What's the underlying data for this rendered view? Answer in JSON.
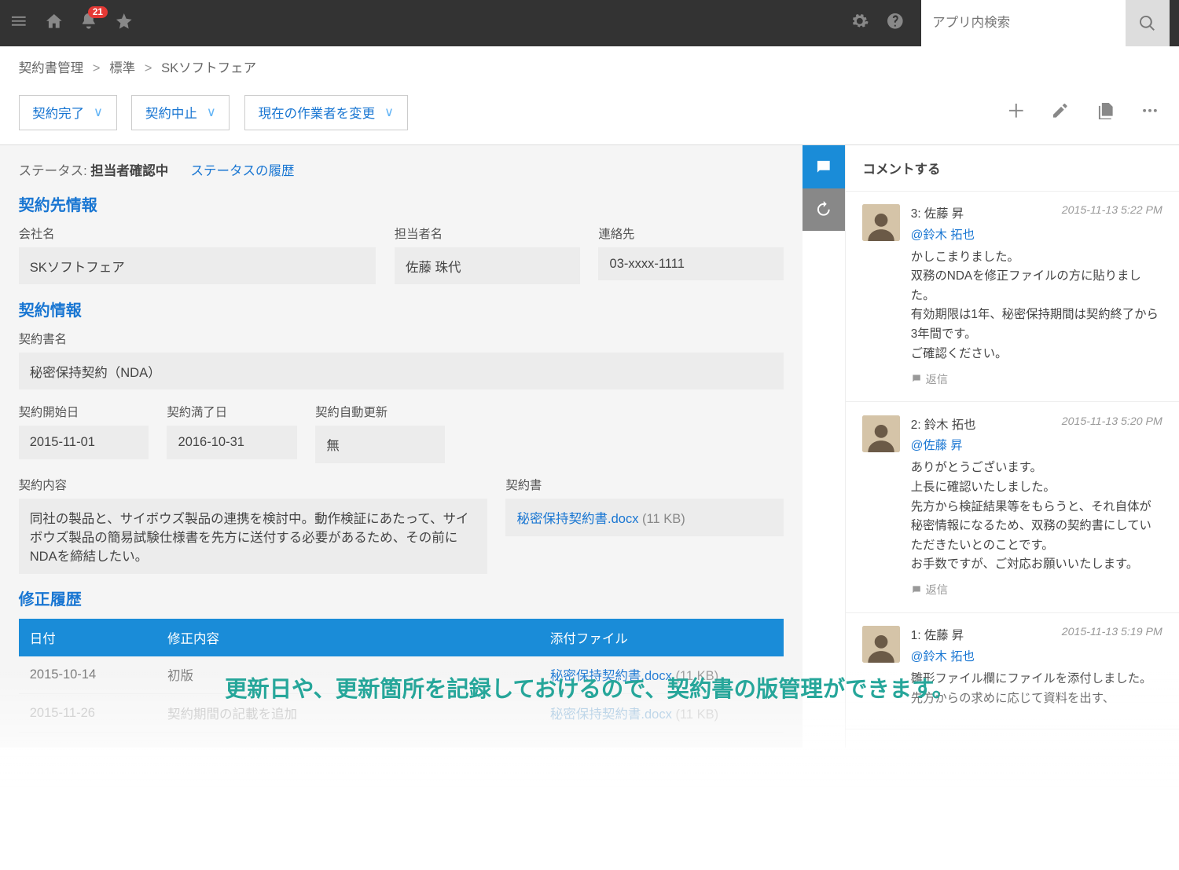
{
  "topbar": {
    "notification_count": "21",
    "search_placeholder": "アプリ内検索"
  },
  "breadcrumb": {
    "parts": [
      "契約書管理",
      "標準",
      "SKソフトフェア"
    ]
  },
  "action_buttons": {
    "complete": "契約完了",
    "cancel": "契約中止",
    "change_worker": "現在の作業者を変更"
  },
  "status": {
    "label": "ステータス:",
    "value": "担当者確認中",
    "history_link": "ステータスの履歴"
  },
  "sections": {
    "party": {
      "title": "契約先情報",
      "company_label": "会社名",
      "company": "SKソフトフェア",
      "contact_label": "担当者名",
      "contact": "佐藤 珠代",
      "phone_label": "連絡先",
      "phone": "03-xxxx-1111"
    },
    "contract": {
      "title": "契約情報",
      "name_label": "契約書名",
      "name": "秘密保持契約（NDA）",
      "start_label": "契約開始日",
      "start": "2015-11-01",
      "end_label": "契約満了日",
      "end": "2016-10-31",
      "renew_label": "契約自動更新",
      "renew": "無",
      "content_label": "契約内容",
      "content": "同社の製品と、サイボウズ製品の連携を検討中。動作検証にあたって、サイボウズ製品の簡易試験仕様書を先方に送付する必要があるため、その前にNDAを締結したい。",
      "doc_label": "契約書",
      "doc_name": "秘密保持契約書.docx",
      "doc_size": "(11 KB)"
    },
    "revisions": {
      "title": "修正履歴",
      "headers": {
        "date": "日付",
        "desc": "修正内容",
        "attach": "添付ファイル"
      },
      "rows": [
        {
          "date": "2015-10-14",
          "desc": "初版",
          "file": "秘密保持契約書.docx",
          "size": "(11 KB)"
        },
        {
          "date": "2015-11-26",
          "desc": "契約期間の記載を追加",
          "file": "秘密保持契約書.docx",
          "size": "(11 KB)"
        }
      ]
    }
  },
  "comments": {
    "header": "コメントする",
    "reply_label": "返信",
    "items": [
      {
        "num": "3",
        "author": "佐藤 昇",
        "time": "2015-11-13 5:22 PM",
        "mention": "@鈴木 拓也",
        "text": "かしこまりました。\n双務のNDAを修正ファイルの方に貼りました。\n有効期限は1年、秘密保持期間は契約終了から3年間です。\nご確認ください。"
      },
      {
        "num": "2",
        "author": "鈴木 拓也",
        "time": "2015-11-13 5:20 PM",
        "mention": "@佐藤 昇",
        "text": "ありがとうございます。\n上長に確認いたしました。\n先方から検証結果等をもらうと、それ自体が秘密情報になるため、双務の契約書にしていただきたいとのことです。\nお手数ですが、ご対応お願いいたします。"
      },
      {
        "num": "1",
        "author": "佐藤 昇",
        "time": "2015-11-13 5:19 PM",
        "mention": "@鈴木 拓也",
        "text": "雛形ファイル欄にファイルを添付しました。\n先方からの求めに応じて資料を出す、"
      }
    ]
  },
  "overlay_caption": "更新日や、更新箇所を記録しておけるので、契約書の版管理ができます。"
}
